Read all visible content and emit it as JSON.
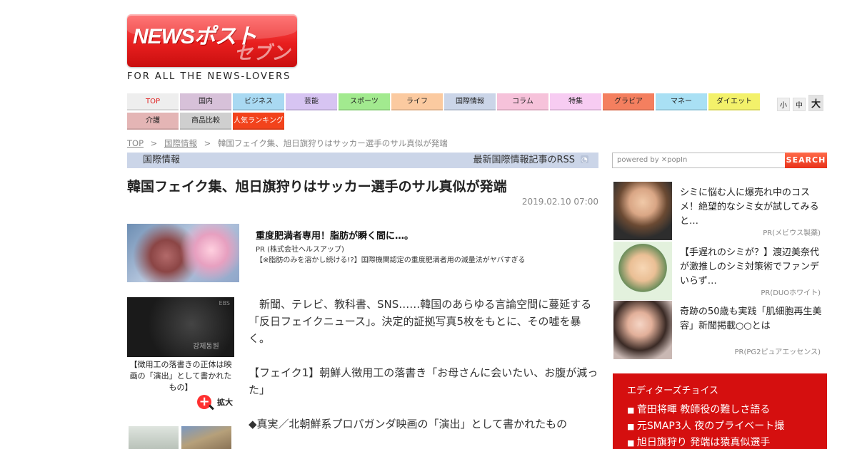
{
  "header": {
    "logo_main": "NEWSポスト",
    "logo_sub": "セブン",
    "tagline": "FOR ALL THE NEWS-LOVERS"
  },
  "nav": {
    "row1": [
      {
        "label": "TOP",
        "color": "#eeeeee"
      },
      {
        "label": "国内",
        "color": "#d7c1d9"
      },
      {
        "label": "ビジネス",
        "color": "#a9d9f2"
      },
      {
        "label": "芸能",
        "color": "#d7c4f2"
      },
      {
        "label": "スポーツ",
        "color": "#a2ea8f"
      },
      {
        "label": "ライフ",
        "color": "#fbcaa0"
      },
      {
        "label": "国際情報",
        "color": "#cbd5e8"
      },
      {
        "label": "コラム",
        "color": "#f6c2da"
      },
      {
        "label": "特集",
        "color": "#f7ccf2"
      },
      {
        "label": "グラビア",
        "color": "#f47f5f"
      },
      {
        "label": "マネー",
        "color": "#a9e0f4"
      },
      {
        "label": "ダイエット",
        "color": "#f3f16a"
      }
    ],
    "row2": [
      {
        "label": "介護",
        "color": "#e4b5b5"
      },
      {
        "label": "商品比較",
        "color": "#cfcfcf"
      },
      {
        "label": "人気ランキング",
        "color": "#f2431c"
      }
    ],
    "font_sizes": [
      "小",
      "中",
      "大"
    ]
  },
  "breadcrumb": {
    "home": "TOP",
    "section": "国際情報",
    "current": "韓国フェイク集、旭日旗狩りはサッカー選手のサル真似が発端"
  },
  "category_bar": {
    "category": "国際情報",
    "rss_label": "最新国際情報記事のRSS"
  },
  "article": {
    "title": "韓国フェイク集、旭日旗狩りはサッカー選手のサル真似が発端",
    "date": "2019.02.10 07:00",
    "pr": {
      "title": "重度肥満者専用！脂肪が瞬く間に…。",
      "sponsor": "PR (株式会社ヘルスアップ)",
      "description": "【※脂肪のみを溶かし続ける!?】国際機関認定の重度肥満者用の減量法がヤバすぎる"
    },
    "figure": {
      "caption": "【徴用工の落書きの正体は映画の「演出」として書かれたもの】",
      "zoom_label": "拡大",
      "overlay_text": "강제동원",
      "channel": "EBS"
    },
    "paragraphs": [
      "　新聞、テレビ、教科書、SNS……韓国のあらゆる言論空間に蔓延する「反日フェイクニュース」。決定的証拠写真5枚をもとに、その嘘を暴く。",
      "【フェイク1】朝鮮人徴用工の落書き「お母さんに会いたい、お腹が減った」",
      "◆真実／北朝鮮系プロパガンダ映画の「演出」として書かれたもの"
    ]
  },
  "sidebar": {
    "search": {
      "placeholder": "powered by ✕popIn",
      "button": "SEARCH"
    },
    "ads": [
      {
        "title": "シミに悩む人に爆売れ中のコスメ！絶望的なシミ女が試してみると…",
        "source": "PR(メビウス製薬)"
      },
      {
        "title": "【手遅れのシミが？】渡辺美奈代が激推しのシミ対策術でファンデいらず…",
        "source": "PR(DUOホワイト)"
      },
      {
        "title": "奇跡の50歳も実践「肌細胞再生美容」新聞掲載○○とは",
        "source": "PR(PG2ピュアエッセンス)"
      }
    ],
    "editors_choice": {
      "heading": "エディターズチョイス",
      "items": [
        "菅田将暉 教師役の難しさ語る",
        "元SMAP3人 夜のプライベート撮",
        "旭日旗狩り 発端は猿真似選手"
      ]
    }
  }
}
